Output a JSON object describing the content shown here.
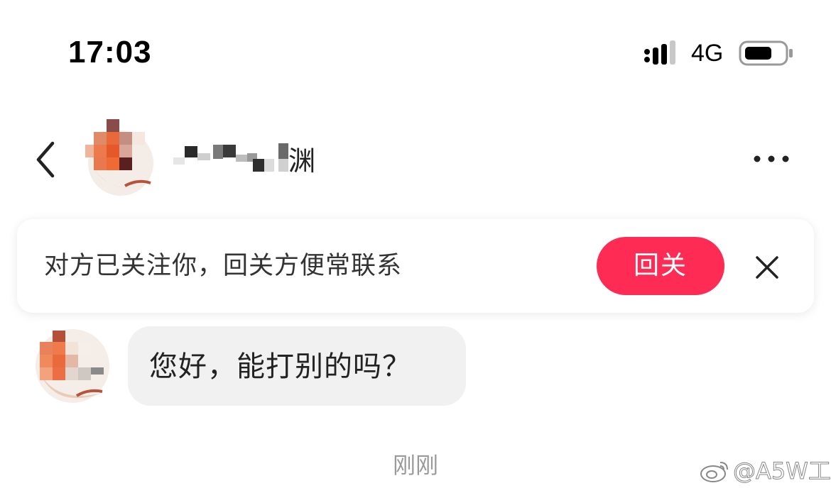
{
  "status_bar": {
    "time": "17:03",
    "network": "4G",
    "icons": [
      "signal-icon",
      "battery-icon"
    ]
  },
  "header": {
    "back_icon": "chevron-left-icon",
    "contact_name_tail": "渊",
    "more_icon": "ellipsis-icon"
  },
  "follow_banner": {
    "text": "对方已关注你，回关方便常联系",
    "button_label": "回关",
    "close_icon": "close-icon",
    "accent_color": "#fe2c55"
  },
  "messages": [
    {
      "text": "您好，能打别的吗？"
    }
  ],
  "timestamp": "刚刚",
  "watermark": {
    "text": "@A5W工",
    "logo_icon": "weibo-logo-icon"
  }
}
